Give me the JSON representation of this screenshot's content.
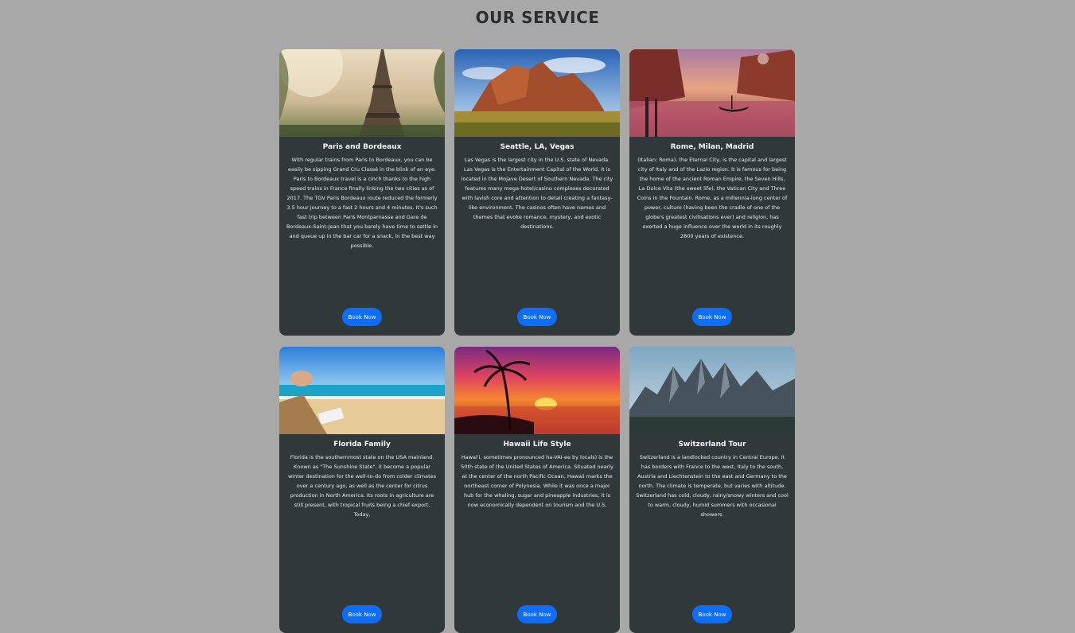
{
  "page": {
    "title": "OUR SERVICE"
  },
  "cards": [
    {
      "title": "Paris and Bordeaux",
      "text": "With regular trains from Paris to Bordeaux, you can be easily be sipping Grand Cru Classé in the blink of an eye. Paris to Bordeaux travel is a cinch thanks to the high speed trains in France finally linking the two cities as of 2017. The TGV Paris Bordeaux route reduced the formerly 3.5 hour journey to a fast 2 hours and 4 minutes. It's such fast trip between Paris Montparnasse and Gare de Bordeaux-Saint-Jean that you barely have time to settle in and queue up in the bar car for a snack, in the best way possible.",
      "button": "Book Now",
      "image": "eiffel-tower-image"
    },
    {
      "title": "Seattle, LA, Vegas",
      "text": "Las Vegas is the largest city in the U.S. state of Nevada. Las Vegas is the Entertainment Capital of the World. It is located in the Mojave Desert of Southern Nevada. The city features many mega-hotel/casino complexes decorated with lavish core and attention to detail creating a fantasy-like environment. The casinos often have names and themes that evoke romance, mystery, and exotic destinations.",
      "button": "Book Now",
      "image": "desert-mountain-image"
    },
    {
      "title": "Rome, Milan, Madrid",
      "text": "(Italian: Roma), the Eternal City, is the capital and largest city of Italy and of the Lazio region. It is famous for being the home of the ancient Roman Empire, the Seven Hills, La Dolce Vita (the sweet life), the Vatican City and Three Coins in the Fountain. Rome, as a millennia-long center of power, culture (having been the cradle of one of the globe's greatest civilisations ever) and religion, has exerted a huge influence over the world in its roughly 2800 years of existence.",
      "button": "Book Now",
      "image": "venice-canal-image"
    },
    {
      "title": "Florida Family",
      "text": "Florida is the southernmost state on the USA mainland. Known as \"The Sunshine State\", it become a popular winter destination for the well-to-do from colder climates over a century ago, as well as the center for citrus production in North America. Its roots in agriculture are still present, with tropical fruits being a chief export. Today,",
      "button": "Book Now",
      "image": "beach-reading-image"
    },
    {
      "title": "Hawaii Life Style",
      "text": "Hawai'i, sometimes pronounced ha-VAI-ee by locals) is the 50th state of the United States of America. Situated nearly at the center of the north Pacific Ocean, Hawaii marks the northeast corner of Polynesia. While it was once a major hub for the whaling, sugar and pineapple industries, it is now economically dependent on tourism and the U.S.",
      "button": "Book Now",
      "image": "palm-sunset-image"
    },
    {
      "title": "Switzerland Tour",
      "text": "Switzerland is a landlocked country in Central Europe. It has borders with France to the west, Italy to the south, Austria and Liechtenstein to the east and Germany to the north. The climate is temperate, but varies with altitude. Switzerland has cold, cloudy, rainy/snowy winters and cool to warm, cloudy, humid summers with occasional showers.",
      "button": "Book Now",
      "image": "alpine-peaks-image"
    }
  ]
}
